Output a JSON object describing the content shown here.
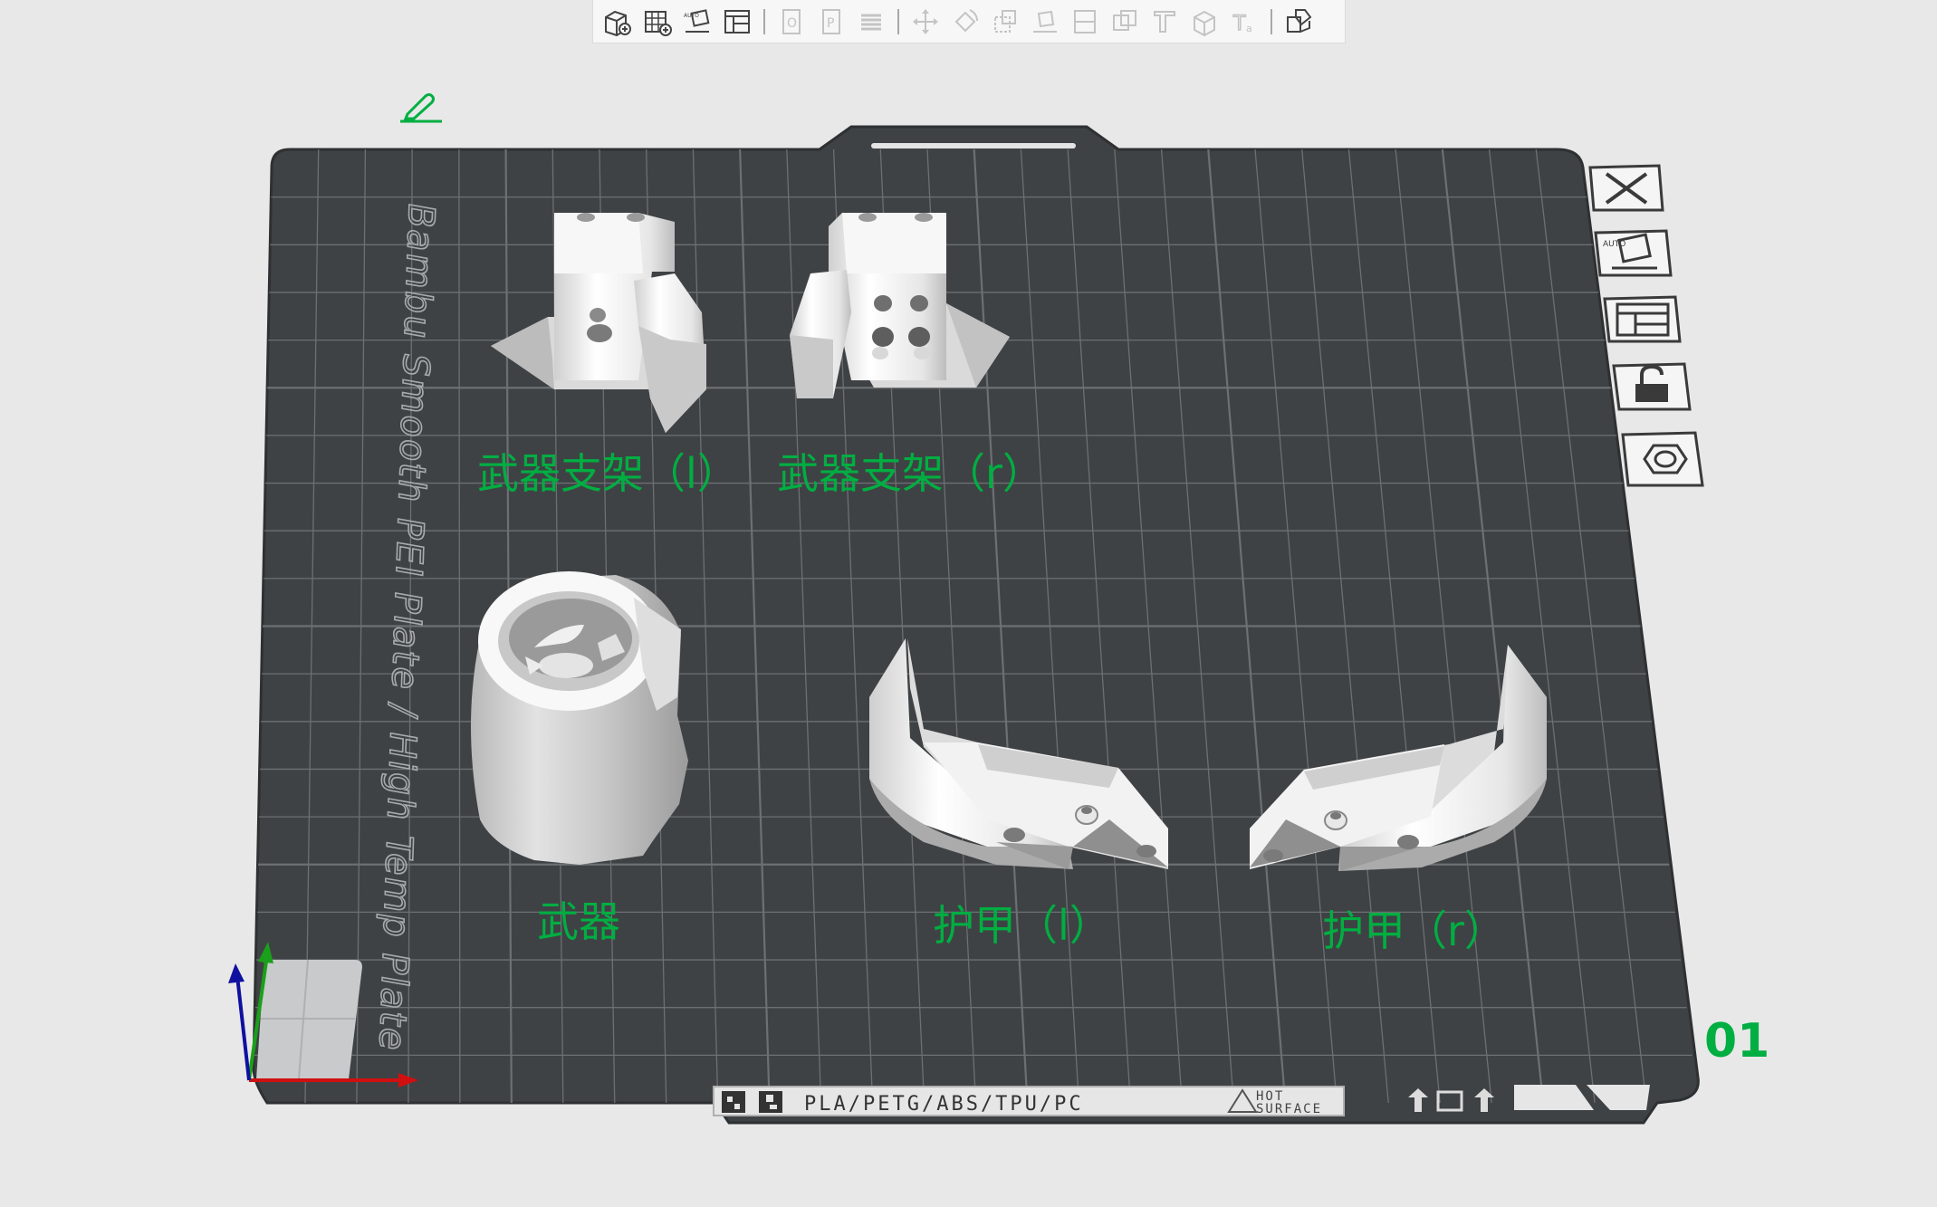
{
  "plate": {
    "name_text": "Bambu Smooth PEI Plate / High Temp Plate",
    "number": "01",
    "footer": {
      "materials": "PLA/PETG/ABS/TPU/PC",
      "hot_line1": "HOT",
      "hot_line2": "SURFACE"
    }
  },
  "objects": [
    {
      "label": "武器支架（l）"
    },
    {
      "label": "武器支架（r）"
    },
    {
      "label": "武器"
    },
    {
      "label": "护甲（l）"
    },
    {
      "label": "护甲（r）"
    }
  ],
  "top_toolbar": {
    "groups": [
      [
        "add-object-icon",
        "add-plate-icon",
        "auto-orient-icon",
        "arrange-icon"
      ],
      [
        "split-objects-icon",
        "split-parts-icon",
        "variable-layer-icon"
      ],
      [
        "move-icon",
        "rotate-icon",
        "scale-icon",
        "lay-on-face-icon",
        "cut-icon",
        "mesh-boolean-icon",
        "support-paint-icon",
        "seam-paint-icon",
        "text-emboss-icon"
      ],
      [
        "assembly-view-icon"
      ]
    ]
  },
  "right_toolbar": [
    "delete-plate-icon",
    "auto-orient-plate-icon",
    "arrange-plate-icon",
    "lock-plate-icon",
    "plate-settings-icon"
  ],
  "colors": {
    "accent": "#00ae42",
    "plate": "#3f4244",
    "grid": "#6c7073",
    "background": "#e8e8e8",
    "model": "#f2f2f2"
  }
}
